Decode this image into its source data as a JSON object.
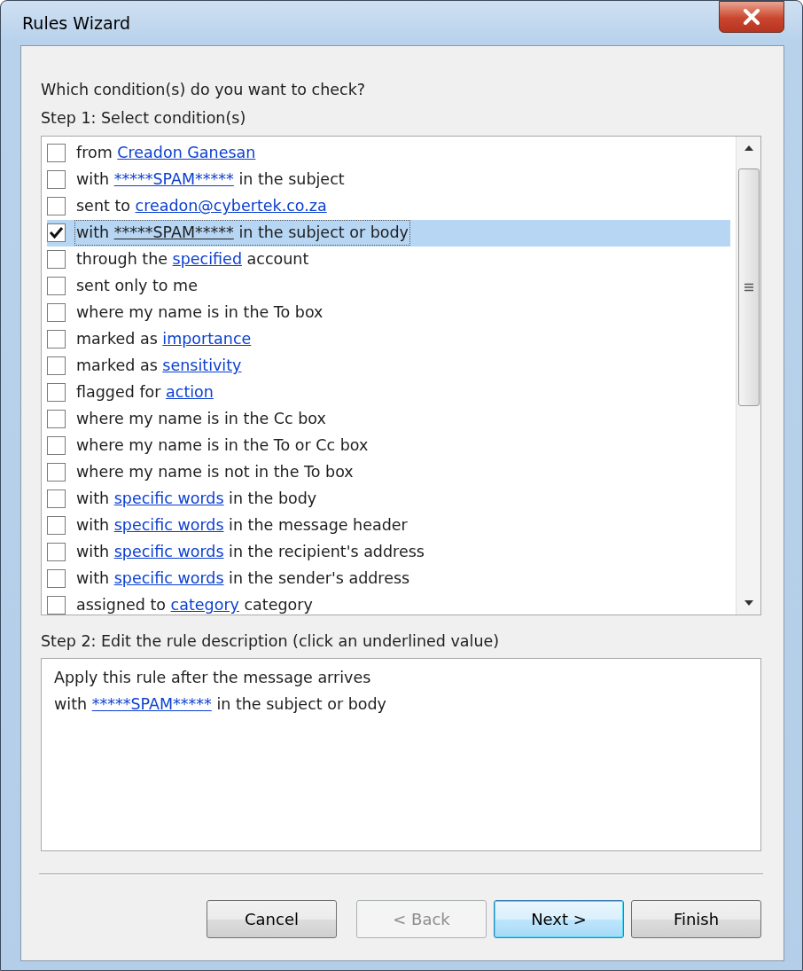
{
  "window": {
    "title": "Rules Wizard"
  },
  "question": "Which condition(s) do you want to check?",
  "step1_label": "Step 1: Select condition(s)",
  "conditions": [
    {
      "before": "from ",
      "link": "Creadon Ganesan",
      "checked": false,
      "selected": false
    },
    {
      "before": "with ",
      "link": "*****SPAM*****",
      "after": " in the subject",
      "checked": false,
      "selected": false
    },
    {
      "before": "sent to ",
      "link": "creadon@cybertek.co.za",
      "checked": false,
      "selected": false
    },
    {
      "before": "with ",
      "link": "*****SPAM*****",
      "after": " in the subject or body",
      "checked": true,
      "selected": true
    },
    {
      "before": "through the ",
      "link": "specified",
      "after": " account",
      "checked": false,
      "selected": false
    },
    {
      "before": "sent only to me",
      "checked": false,
      "selected": false
    },
    {
      "before": "where my name is in the To box",
      "checked": false,
      "selected": false
    },
    {
      "before": "marked as ",
      "link": "importance",
      "checked": false,
      "selected": false
    },
    {
      "before": "marked as ",
      "link": "sensitivity",
      "checked": false,
      "selected": false
    },
    {
      "before": "flagged for ",
      "link": "action",
      "checked": false,
      "selected": false
    },
    {
      "before": "where my name is in the Cc box",
      "checked": false,
      "selected": false
    },
    {
      "before": "where my name is in the To or Cc box",
      "checked": false,
      "selected": false
    },
    {
      "before": "where my name is not in the To box",
      "checked": false,
      "selected": false
    },
    {
      "before": "with ",
      "link": "specific words",
      "after": " in the body",
      "checked": false,
      "selected": false
    },
    {
      "before": "with ",
      "link": "specific words",
      "after": " in the message header",
      "checked": false,
      "selected": false
    },
    {
      "before": "with ",
      "link": "specific words",
      "after": " in the recipient's address",
      "checked": false,
      "selected": false
    },
    {
      "before": "with ",
      "link": "specific words",
      "after": " in the sender's address",
      "checked": false,
      "selected": false
    },
    {
      "before": "assigned to ",
      "link": "category",
      "after": " category",
      "checked": false,
      "selected": false
    }
  ],
  "step2_label": "Step 2: Edit the rule description (click an underlined value)",
  "description": [
    {
      "before": "Apply this rule after the message arrives"
    },
    {
      "before": "with ",
      "link": "*****SPAM*****",
      "after": " in the subject or body"
    }
  ],
  "buttons": [
    {
      "label": "Cancel",
      "disabled": false,
      "default": false
    },
    {
      "label": "< Back",
      "disabled": true,
      "default": false
    },
    {
      "label": "Next >",
      "disabled": false,
      "default": true
    },
    {
      "label": "Finish",
      "disabled": false,
      "default": false
    }
  ]
}
